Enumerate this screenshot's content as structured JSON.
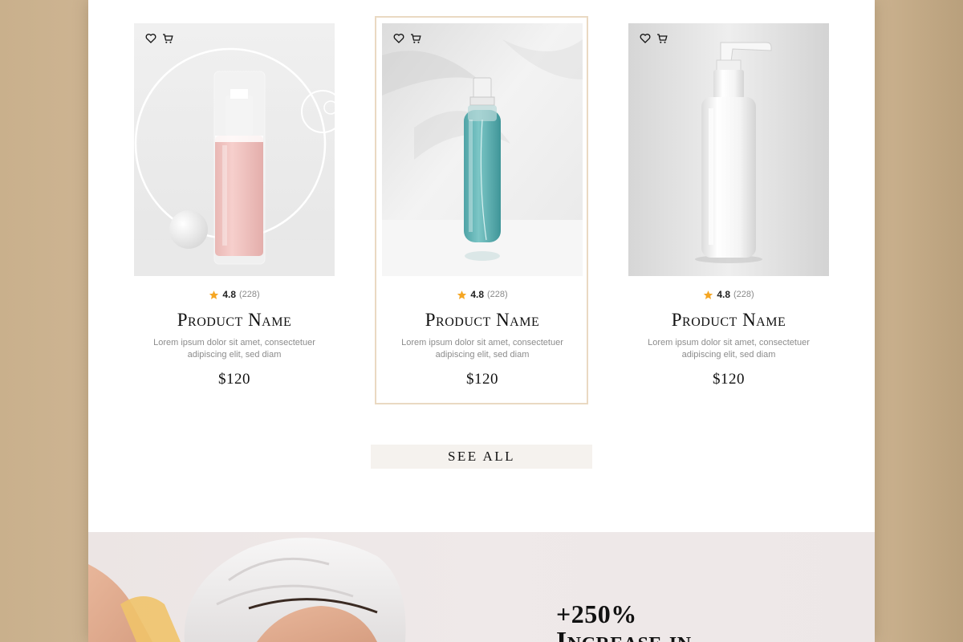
{
  "products": [
    {
      "rating": "4.8",
      "reviews": "(228)",
      "name": "Product Name",
      "description": "Lorem ipsum dolor sit amet, consectetuer adipiscing elit, sed diam",
      "price": "$120",
      "image": "pink-serum-bottle"
    },
    {
      "rating": "4.8",
      "reviews": "(228)",
      "name": "Product Name",
      "description": "Lorem ipsum dolor sit amet, consectetuer adipiscing elit, sed diam",
      "price": "$120",
      "image": "teal-spray-bottle",
      "highlighted": true
    },
    {
      "rating": "4.8",
      "reviews": "(228)",
      "name": "Product Name",
      "description": "Lorem ipsum dolor sit amet, consectetuer adipiscing elit, sed diam",
      "price": "$120",
      "image": "white-pump-bottle"
    }
  ],
  "see_all_label": "SEE ALL",
  "hero": {
    "stat": "+250%",
    "heading": "Increase in"
  },
  "icons": {
    "wishlist": "heart-icon",
    "cart": "cart-icon",
    "rating": "star-icon"
  },
  "colors": {
    "accent_star": "#f5a623",
    "highlight_border": "#ead9c2",
    "button_bg": "#f5f2ee",
    "frame_bg": "#c8b08e"
  }
}
